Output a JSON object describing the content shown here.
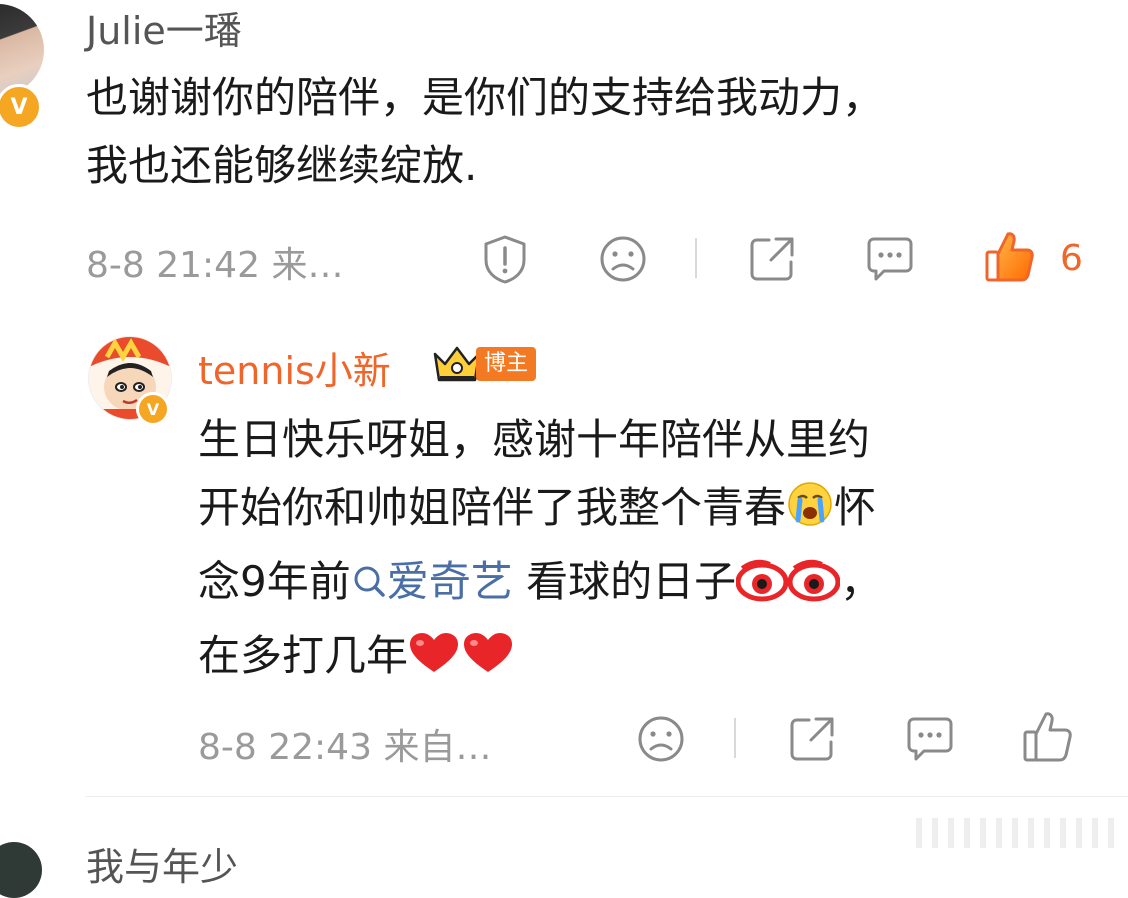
{
  "comments": [
    {
      "author": "Julie一璠",
      "verified": "V",
      "content_line1": "也谢谢你的陪伴，是你们的支持给我动力，",
      "content_line2": "我也还能够继续绽放.",
      "time": "8-8 21:42",
      "source": "来…",
      "likes": "6",
      "liked": true
    },
    {
      "author": "tennis小新",
      "verified": "V",
      "tag": "博主",
      "line1": "生日快乐呀姐，感谢十年陪伴从里约",
      "line2_pre": "开始你和帅姐陪伴了我整个青春",
      "line2_post": "怀",
      "line3_pre": "念9年前",
      "line3_link": "爱奇艺",
      "line3_post": " 看球的日子",
      "line3_end": "，",
      "line4_pre": "在多打几年",
      "time": "8-8 22:43",
      "source": "来自…"
    },
    {
      "author": "我与年少"
    }
  ],
  "colors": {
    "accent": "#f06529",
    "link": "#4a6fa5",
    "meta": "#9a9a9a",
    "verified": "#f5a623"
  },
  "icons": [
    "report-icon",
    "sad-face-icon",
    "share-icon",
    "comment-icon",
    "like-icon",
    "search-link-icon",
    "crying-emoji",
    "eyes-emoji",
    "heart-emoji",
    "crown-icon"
  ]
}
